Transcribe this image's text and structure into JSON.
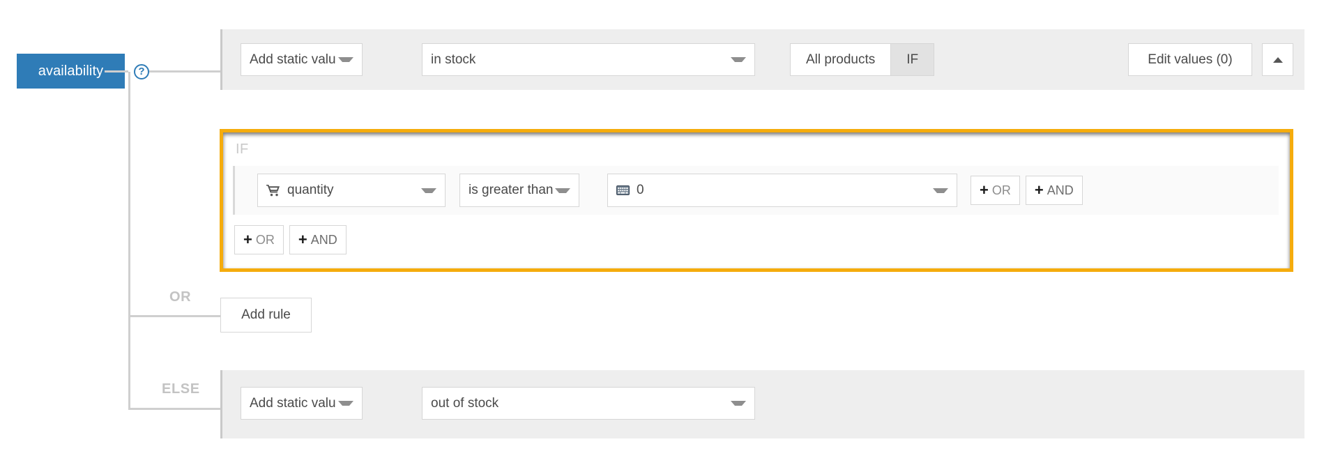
{
  "field": {
    "tag_label": "availability",
    "help_icon": "question-mark-icon"
  },
  "tree": {
    "branch_or": "OR",
    "branch_else": "ELSE"
  },
  "then_row": {
    "source_select": "Add static valu",
    "value_select": "in stock",
    "scope_all_products": "All products",
    "scope_if": "IF",
    "edit_values_button": "Edit values (0)",
    "collapse_icon": "chevron-up-icon"
  },
  "if_block": {
    "label": "IF",
    "border_color": "#f5ac0d",
    "condition": {
      "field_icon": "shopping-cart-icon",
      "field": "quantity",
      "operator": "is greater than",
      "value_icon": "keyboard-icon",
      "value": "0"
    },
    "row_buttons": {
      "or": "OR",
      "and": "AND",
      "plus": "+"
    },
    "block_buttons": {
      "or": "OR",
      "and": "AND",
      "plus": "+"
    }
  },
  "add_rule_button": "Add rule",
  "else_row": {
    "source_select": "Add static valu",
    "value_select": "out of stock"
  },
  "colors": {
    "tag_blue": "#2f7cb7",
    "highlight_orange": "#f5ac0d",
    "panel_gray": "#eeeeee",
    "muted_text": "#c3c3c3"
  }
}
